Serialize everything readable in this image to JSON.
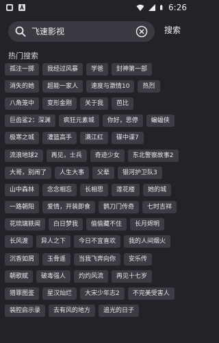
{
  "status_bar": {
    "time": "6:26",
    "icons": [
      "notification-icon",
      "app-a-icon",
      "wifi-icon",
      "signal-icon",
      "battery-icon"
    ]
  },
  "search": {
    "value": "飞速影视",
    "button_label": "搜索"
  },
  "hot_search": {
    "title": "热门搜索",
    "rows": [
      [
        "孤注一掷",
        "我经过风暴",
        "学爸",
        "封神第一部"
      ],
      [
        "消失的她",
        "超能一家人",
        "速度与激情10",
        "热烈"
      ],
      [
        "八角笼中",
        "变形金刚",
        "关于我",
        "芭比"
      ],
      [
        "巨齿鲨2：深渊",
        "疯狂元素城",
        "你好，思停",
        "蝙蝠侠"
      ],
      [
        "极寒之城",
        "灌篮高手",
        "满江红",
        "碟中谍7"
      ],
      [
        "流浪地球2",
        "再见，士兵",
        "奇迹少女",
        "东北警察故事2"
      ],
      [
        "大哥，别闹了",
        "人生大事",
        "父辈",
        "银河护卫队3"
      ],
      [
        "山中森林",
        "念念相忘",
        "长相思",
        "莲花楼",
        "她的城"
      ],
      [
        "一路朝阳",
        "爱情，开装即食",
        "鹊刀门传奇",
        "七时吉祥"
      ],
      [
        "花琉璃轶闻",
        "白日梦我",
        "偷偷藏不住",
        "长月烬明"
      ],
      [
        "长风渡",
        "异人之下",
        "今日不宜喜欢",
        "我的人间烟火"
      ],
      [
        "沉香如屑",
        "玉骨遥",
        "当我飞奔向你",
        "安乐传"
      ],
      [
        "朝歌赋",
        "破毒强人",
        "灼灼风流",
        "再见十七岁"
      ],
      [
        "猎罪图鉴",
        "星汉灿烂",
        "大宋少年志2",
        "不完美受害人"
      ],
      [
        "装腔启示录",
        "去有风的地方",
        "追光的日子"
      ]
    ]
  }
}
